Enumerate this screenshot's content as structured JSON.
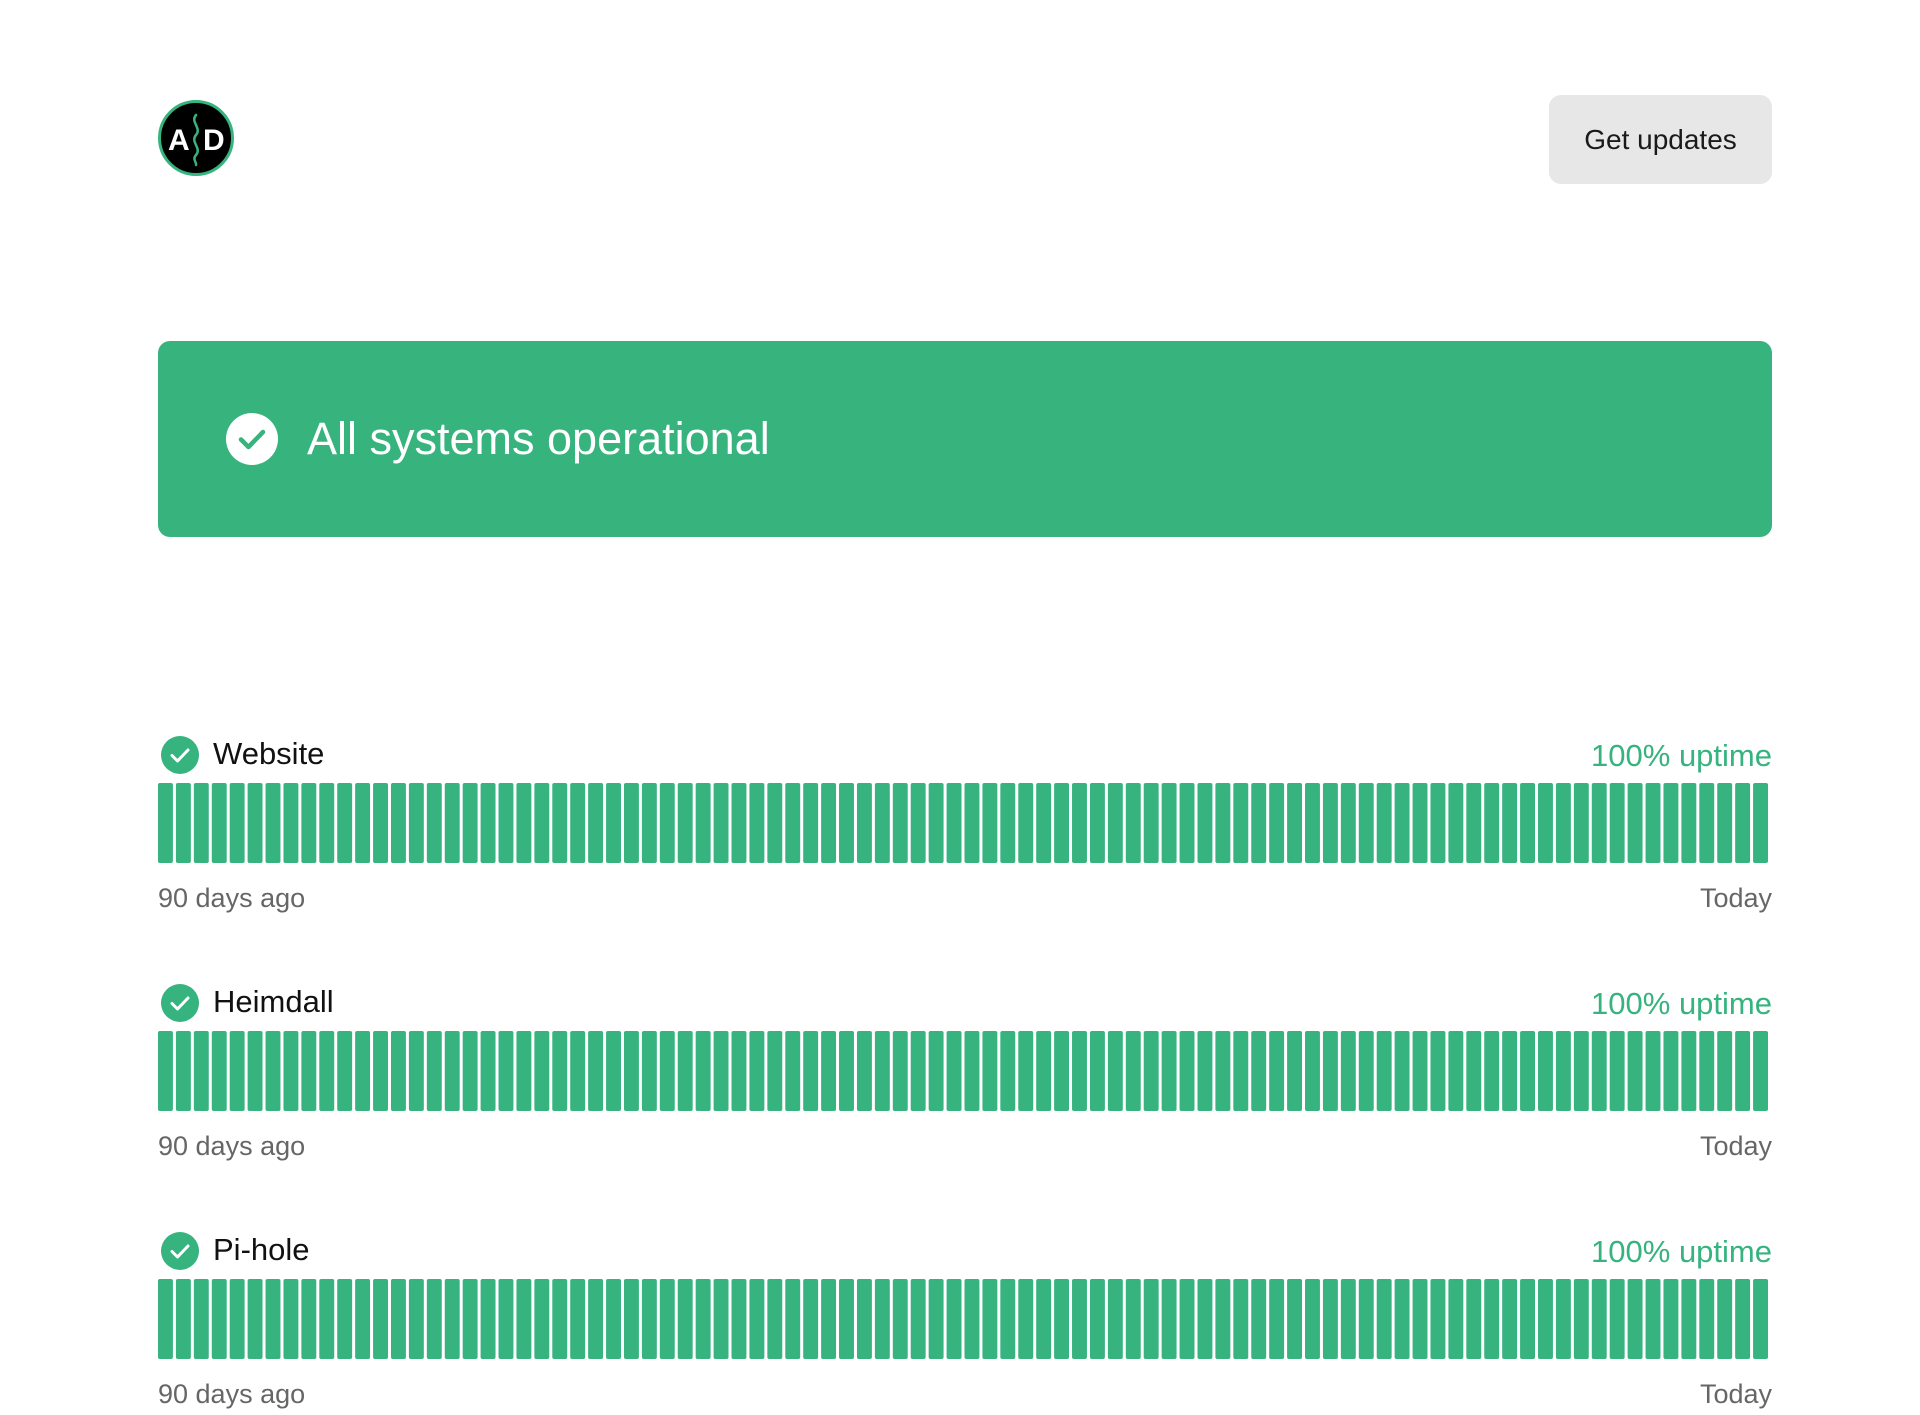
{
  "header": {
    "logo_text": "A D",
    "logo_icon": "ad-logo-icon",
    "updates_label": "Get updates"
  },
  "banner": {
    "icon": "check-circle-icon",
    "title": "All systems operational"
  },
  "colors": {
    "accent": "#37b37e",
    "button_bg": "#e7e7e7",
    "muted_text": "#666666"
  },
  "services": [
    {
      "name": "Website",
      "uptime": "100% uptime",
      "range_start": "90 days ago",
      "range_end": "Today",
      "days": 90,
      "status_icon": "check-circle-icon"
    },
    {
      "name": "Heimdall",
      "uptime": "100% uptime",
      "range_start": "90 days ago",
      "range_end": "Today",
      "days": 90,
      "status_icon": "check-circle-icon"
    },
    {
      "name": "Pi-hole",
      "uptime": "100% uptime",
      "range_start": "90 days ago",
      "range_end": "Today",
      "days": 90,
      "status_icon": "check-circle-icon"
    }
  ]
}
